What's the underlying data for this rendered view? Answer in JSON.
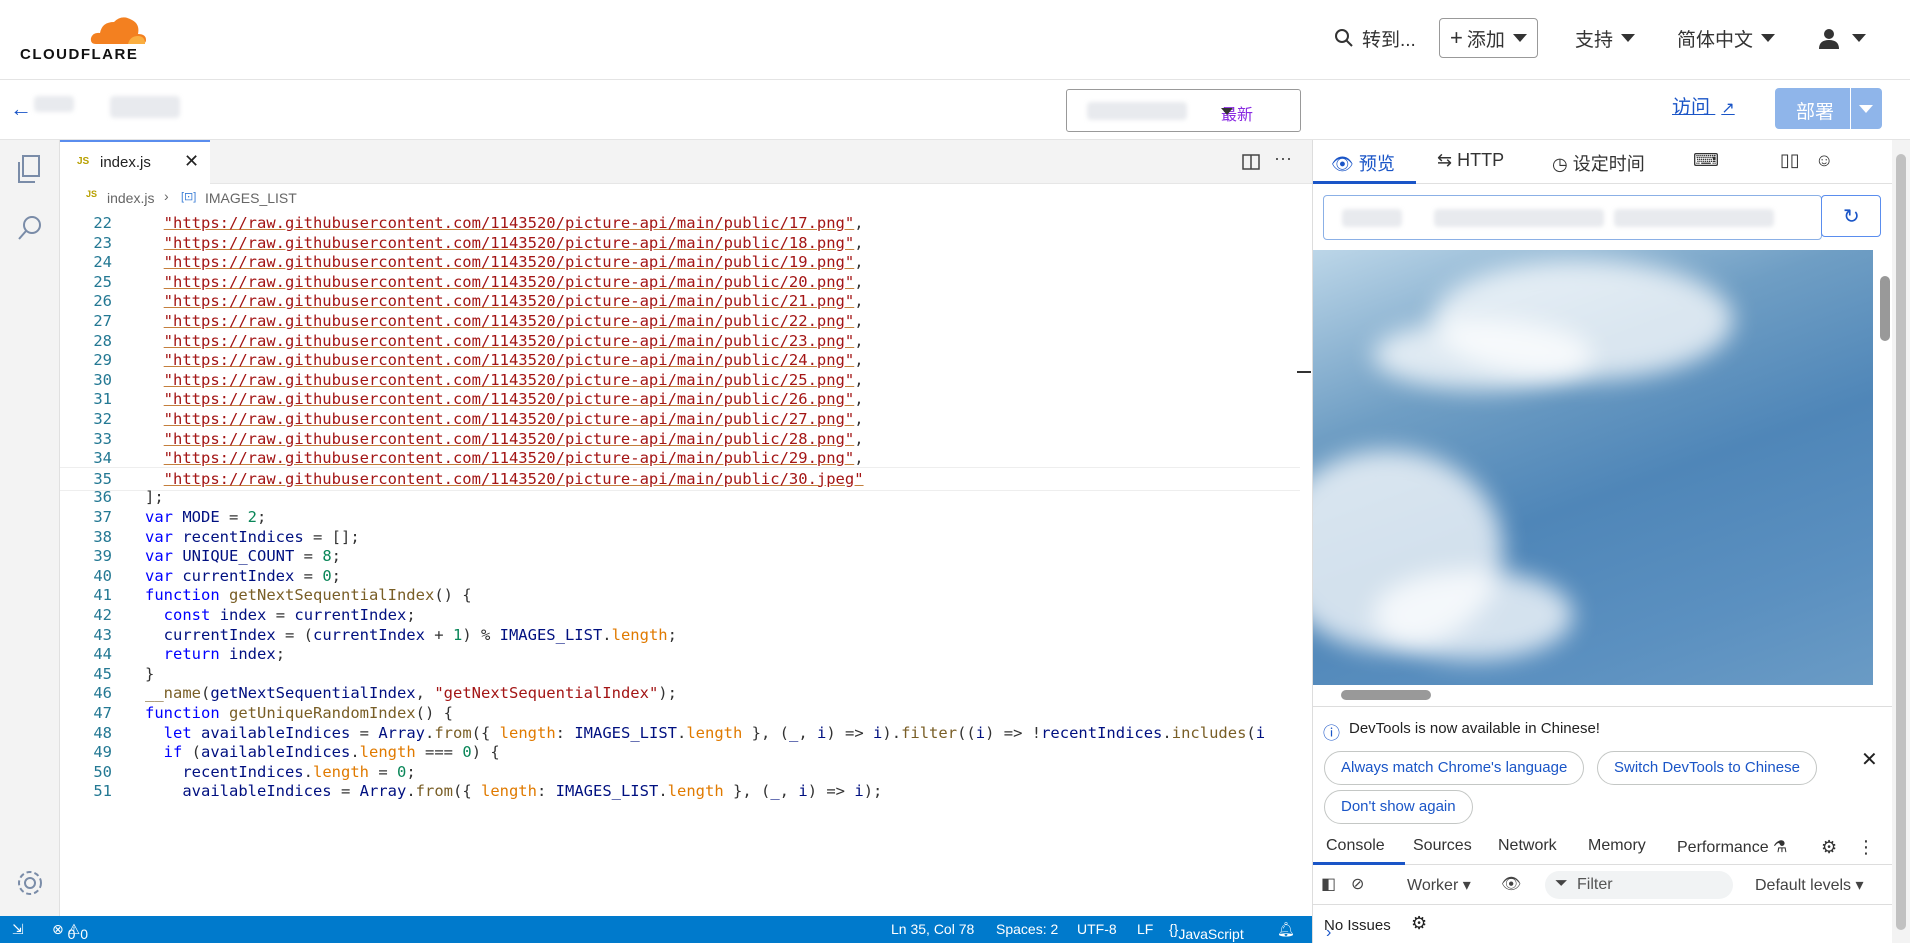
{
  "topbar": {
    "logo_text": "CLOUDFLARE",
    "goto_label": "转到...",
    "add_label": "添加",
    "support_label": "支持",
    "language_label": "简体中文",
    "icons": {
      "search": "search-icon",
      "plus": "plus-icon",
      "user": "user-icon"
    }
  },
  "subbar": {
    "version_label": "最新",
    "visit_label": "访问",
    "deploy_label": "部署"
  },
  "editor": {
    "tab_name": "index.js",
    "tab_badge": "JS",
    "breadcrumb_file": "index.js",
    "breadcrumb_symbol": "IMAGES_LIST"
  },
  "code_lines": [
    {
      "n": "22",
      "t": "url",
      "s": "\"https://raw.githubusercontent.com/1143520/picture-api/main/public/17.png\"",
      "tail": ","
    },
    {
      "n": "23",
      "t": "url",
      "s": "\"https://raw.githubusercontent.com/1143520/picture-api/main/public/18.png\"",
      "tail": ","
    },
    {
      "n": "24",
      "t": "url",
      "s": "\"https://raw.githubusercontent.com/1143520/picture-api/main/public/19.png\"",
      "tail": ","
    },
    {
      "n": "25",
      "t": "url",
      "s": "\"https://raw.githubusercontent.com/1143520/picture-api/main/public/20.png\"",
      "tail": ","
    },
    {
      "n": "26",
      "t": "url",
      "s": "\"https://raw.githubusercontent.com/1143520/picture-api/main/public/21.png\"",
      "tail": ","
    },
    {
      "n": "27",
      "t": "url",
      "s": "\"https://raw.githubusercontent.com/1143520/picture-api/main/public/22.png\"",
      "tail": ","
    },
    {
      "n": "28",
      "t": "url",
      "s": "\"https://raw.githubusercontent.com/1143520/picture-api/main/public/23.png\"",
      "tail": ","
    },
    {
      "n": "29",
      "t": "url",
      "s": "\"https://raw.githubusercontent.com/1143520/picture-api/main/public/24.png\"",
      "tail": ","
    },
    {
      "n": "30",
      "t": "url",
      "s": "\"https://raw.githubusercontent.com/1143520/picture-api/main/public/25.png\"",
      "tail": ","
    },
    {
      "n": "31",
      "t": "url",
      "s": "\"https://raw.githubusercontent.com/1143520/picture-api/main/public/26.png\"",
      "tail": ","
    },
    {
      "n": "32",
      "t": "url",
      "s": "\"https://raw.githubusercontent.com/1143520/picture-api/main/public/27.png\"",
      "tail": ","
    },
    {
      "n": "33",
      "t": "url",
      "s": "\"https://raw.githubusercontent.com/1143520/picture-api/main/public/28.png\"",
      "tail": ","
    },
    {
      "n": "34",
      "t": "url",
      "s": "\"https://raw.githubusercontent.com/1143520/picture-api/main/public/29.png\"",
      "tail": ","
    },
    {
      "n": "35",
      "t": "url",
      "s": "\"https://raw.githubusercontent.com/1143520/picture-api/main/public/30.jpeg\"",
      "tail": "",
      "current": true
    },
    {
      "n": "36",
      "t": "plain",
      "s": "];"
    },
    {
      "n": "37",
      "t": "plain",
      "s": "var MODE = 2;"
    },
    {
      "n": "38",
      "t": "plain",
      "s": "var recentIndices = [];"
    },
    {
      "n": "39",
      "t": "plain",
      "s": "var UNIQUE_COUNT = 8;"
    },
    {
      "n": "40",
      "t": "plain",
      "s": "var currentIndex = 0;"
    },
    {
      "n": "41",
      "t": "plain",
      "s": "function getNextSequentialIndex() {"
    },
    {
      "n": "42",
      "t": "plain",
      "s": "  const index = currentIndex;"
    },
    {
      "n": "43",
      "t": "plain",
      "s": "  currentIndex = (currentIndex + 1) % IMAGES_LIST.length;"
    },
    {
      "n": "44",
      "t": "plain",
      "s": "  return index;"
    },
    {
      "n": "45",
      "t": "plain",
      "s": "}"
    },
    {
      "n": "46",
      "t": "plain",
      "s": "__name(getNextSequentialIndex, \"getNextSequentialIndex\");"
    },
    {
      "n": "47",
      "t": "plain",
      "s": "function getUniqueRandomIndex() {"
    },
    {
      "n": "48",
      "t": "plain",
      "s": "  let availableIndices = Array.from({ length: IMAGES_LIST.length }, (_, i) => i).filter((i) => !recentIndices.includes(i"
    },
    {
      "n": "49",
      "t": "plain",
      "s": "  if (availableIndices.length === 0) {"
    },
    {
      "n": "50",
      "t": "plain",
      "s": "    recentIndices.length = 0;"
    },
    {
      "n": "51",
      "t": "plain",
      "s": "    availableIndices = Array.from({ length: IMAGES_LIST.length }, (_, i) => i);"
    }
  ],
  "statusbar": {
    "errors": "0",
    "warnings": "0",
    "position": "Ln 35, Col 78",
    "spaces": "Spaces: 2",
    "encoding": "UTF-8",
    "eol": "LF",
    "language": "JavaScript"
  },
  "preview_panel": {
    "tab_preview": "预览",
    "tab_http": "HTTP",
    "tab_schedule": "设定时间"
  },
  "devtools": {
    "banner": "DevTools is now available in Chinese!",
    "btn_match": "Always match Chrome's language",
    "btn_switch": "Switch DevTools to Chinese",
    "btn_dont_show": "Don't show again",
    "tabs": [
      "Console",
      "Sources",
      "Network",
      "Memory",
      "Performance"
    ],
    "context": "Worker",
    "filter_placeholder": "Filter",
    "levels": "Default levels",
    "issues": "No Issues",
    "prompt": "›"
  }
}
